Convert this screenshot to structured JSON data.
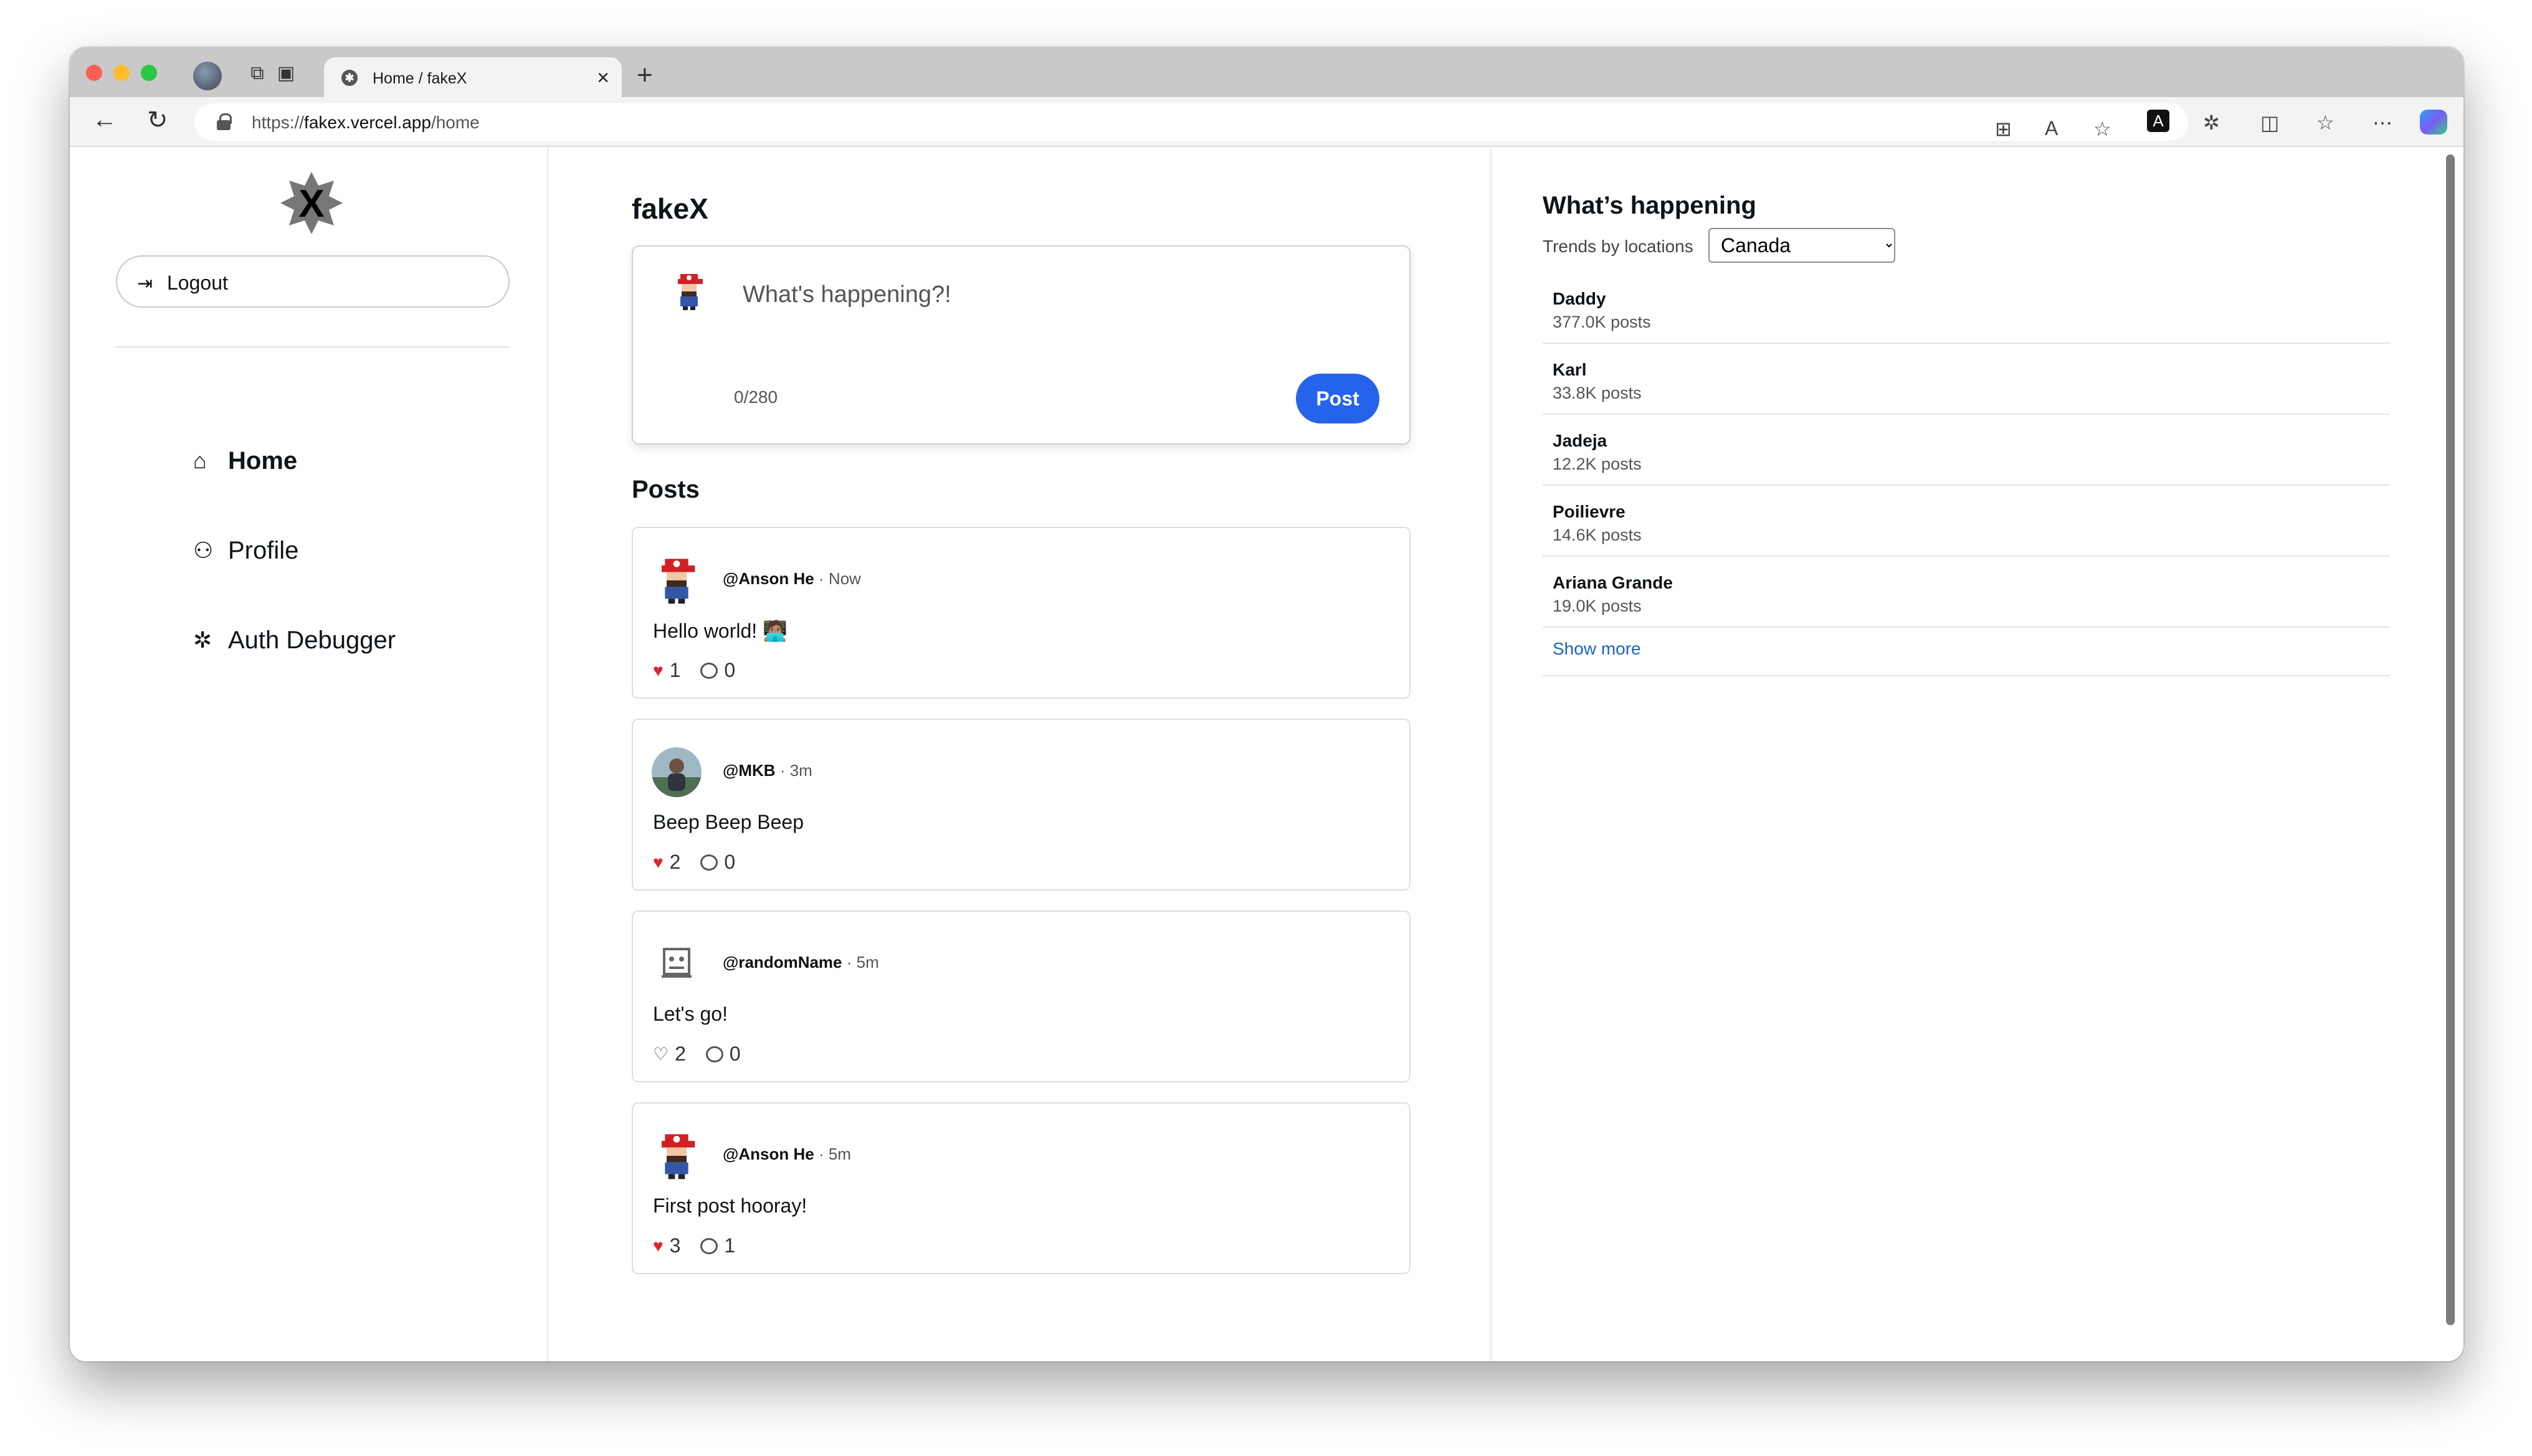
{
  "browser": {
    "tab_title": "Home / fakeX",
    "tab_close": "×",
    "new_tab": "+",
    "url_prefix": "https://",
    "url_host": "fakex.vercel.app",
    "url_path": "/home"
  },
  "sidebar": {
    "logout_label": "Logout",
    "nav": [
      {
        "label": "Home",
        "icon": "home-icon"
      },
      {
        "label": "Profile",
        "icon": "user-icon"
      },
      {
        "label": "Auth Debugger",
        "icon": "bug-icon"
      }
    ]
  },
  "feed": {
    "title": "fakeX",
    "composer": {
      "placeholder": "What's happening?!",
      "count": "0/280",
      "post_label": "Post"
    },
    "posts_heading": "Posts",
    "posts": [
      {
        "handle": "@Anson He",
        "time": "Now",
        "text": "Hello world! 🧑🏽‍💻",
        "likes": "1",
        "liked": true,
        "comments": "0"
      },
      {
        "handle": "@MKB",
        "time": "3m",
        "text": "Beep Beep Beep",
        "likes": "2",
        "liked": true,
        "comments": "0"
      },
      {
        "handle": "@randomName",
        "time": "5m",
        "text": "Let's go!",
        "likes": "2",
        "liked": false,
        "comments": "0"
      },
      {
        "handle": "@Anson He",
        "time": "5m",
        "text": "First post hooray!",
        "likes": "3",
        "liked": true,
        "comments": "1"
      }
    ]
  },
  "trends": {
    "title": "What’s happening",
    "location_label": "Trends by locations",
    "location_selected": "Canada",
    "items": [
      {
        "name": "Daddy",
        "count": "377.0K posts"
      },
      {
        "name": "Karl",
        "count": "33.8K posts"
      },
      {
        "name": "Jadeja",
        "count": "12.2K posts"
      },
      {
        "name": "Poilievre",
        "count": "14.6K posts"
      },
      {
        "name": "Ariana Grande",
        "count": "19.0K posts"
      }
    ],
    "show_more": "Show more"
  },
  "colors": {
    "accent": "#2563eb",
    "like": "#e02434",
    "link": "#1d62c4"
  }
}
